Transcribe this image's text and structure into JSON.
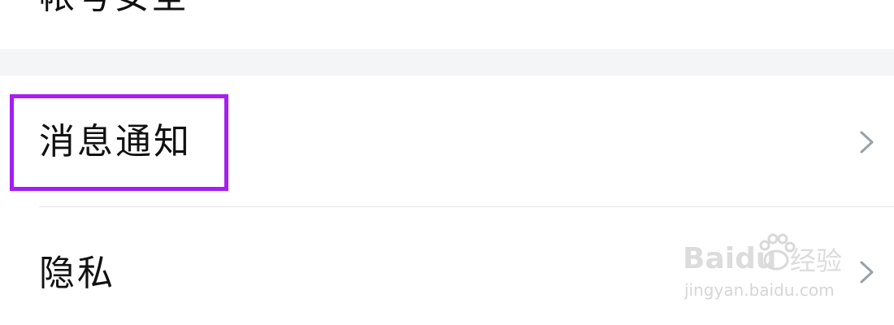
{
  "settings": {
    "top_partial_label": "帐号安全",
    "rows": [
      {
        "label": "消息通知",
        "chevron": "chevron-right-icon",
        "highlighted": true
      },
      {
        "label": "隐私",
        "chevron": "chevron-right-icon",
        "highlighted": false
      }
    ]
  },
  "annotation": {
    "highlight_color": "#a51ef2"
  },
  "watermark": {
    "logo_text": "Baidu",
    "cn_text": "经验",
    "url": "jingyan.baidu.com"
  },
  "colors": {
    "background": "#ffffff",
    "section_gap": "#f4f5f7",
    "text": "#111111",
    "chevron": "#9aa0a6",
    "divider": "#e6e6e6"
  }
}
